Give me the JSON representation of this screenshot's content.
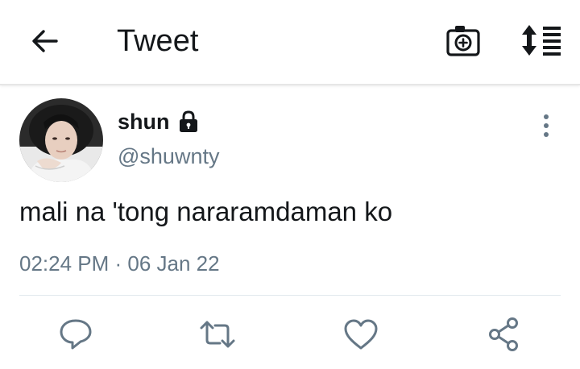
{
  "header": {
    "title": "Tweet",
    "back_icon": "arrow-left-icon",
    "camera_icon": "camera-plus-icon",
    "sort_icon": "sort-list-icon"
  },
  "tweet": {
    "display_name": "shun",
    "handle": "@shuwnty",
    "protected_icon": "lock-icon",
    "text": "mali na 'tong nararamdaman ko",
    "timestamp": "02:24 PM · 06 Jan 22"
  },
  "actions": [
    {
      "icon": "reply-icon"
    },
    {
      "icon": "retweet-icon"
    },
    {
      "icon": "heart-icon"
    },
    {
      "icon": "share-icon"
    }
  ],
  "colors": {
    "text_primary": "#14171a",
    "text_secondary": "#657786",
    "icon_gray": "#657786",
    "divider": "#e1e8ed"
  }
}
